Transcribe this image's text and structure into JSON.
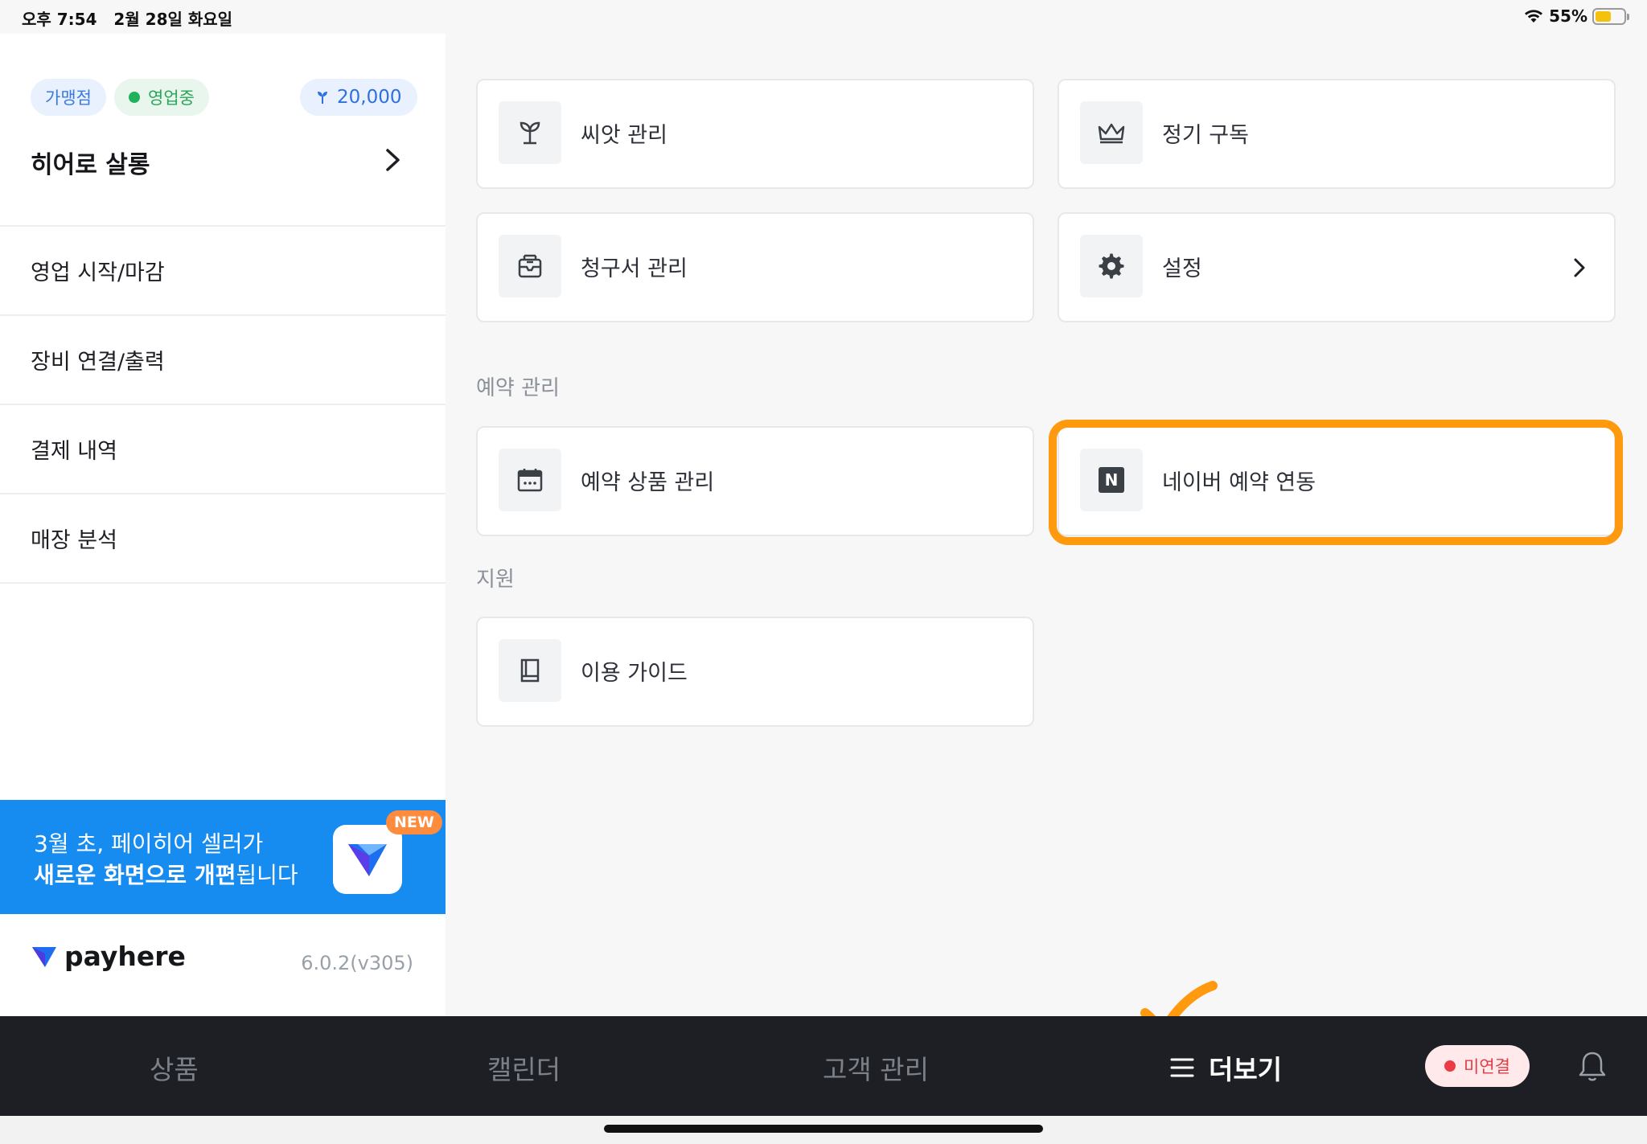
{
  "status_bar": {
    "time": "오후 7:54",
    "date": "2월 28일 화요일",
    "battery": "55%",
    "battery_color": "#f4c20d"
  },
  "sidebar": {
    "chips": {
      "franchise": "가맹점",
      "open_status": "영업중",
      "seed_balance": "20,000"
    },
    "store_name": "히어로 살롱",
    "menu": [
      {
        "label": "영업 시작/마감"
      },
      {
        "label": "장비 연결/출력"
      },
      {
        "label": "결제 내역"
      },
      {
        "label": "매장 분석"
      }
    ],
    "banner": {
      "line1": "3월 초, 페이히어 셀러가",
      "line2_bold": "새로운 화면으로 개편",
      "line2_rest": "됩니다",
      "badge": "NEW",
      "bg_color": "#168bf0"
    },
    "brand": "payhere",
    "version": "6.0.2(v305)"
  },
  "main": {
    "cards_top": [
      {
        "label": "씨앗 관리",
        "icon": "sprout-icon"
      },
      {
        "label": "정기 구독",
        "icon": "crown-icon"
      },
      {
        "label": "청구서 관리",
        "icon": "invoice-icon"
      },
      {
        "label": "설정",
        "icon": "gear-icon"
      }
    ],
    "reservation_section": {
      "title": "예약 관리",
      "cards": [
        {
          "label": "예약 상품 관리",
          "icon": "calendar-icon"
        },
        {
          "label": "네이버 예약 연동",
          "icon": "naver-icon",
          "icon_text": "N"
        }
      ]
    },
    "support_section": {
      "title": "지원",
      "cards": [
        {
          "label": "이용 가이드",
          "icon": "book-icon"
        }
      ]
    },
    "highlight_color": "#ff9a0f"
  },
  "bottom_nav": {
    "tabs": [
      "상품",
      "캘린더",
      "고객 관리",
      "더보기"
    ],
    "active_tab": "더보기",
    "connection_status": "미연결"
  }
}
